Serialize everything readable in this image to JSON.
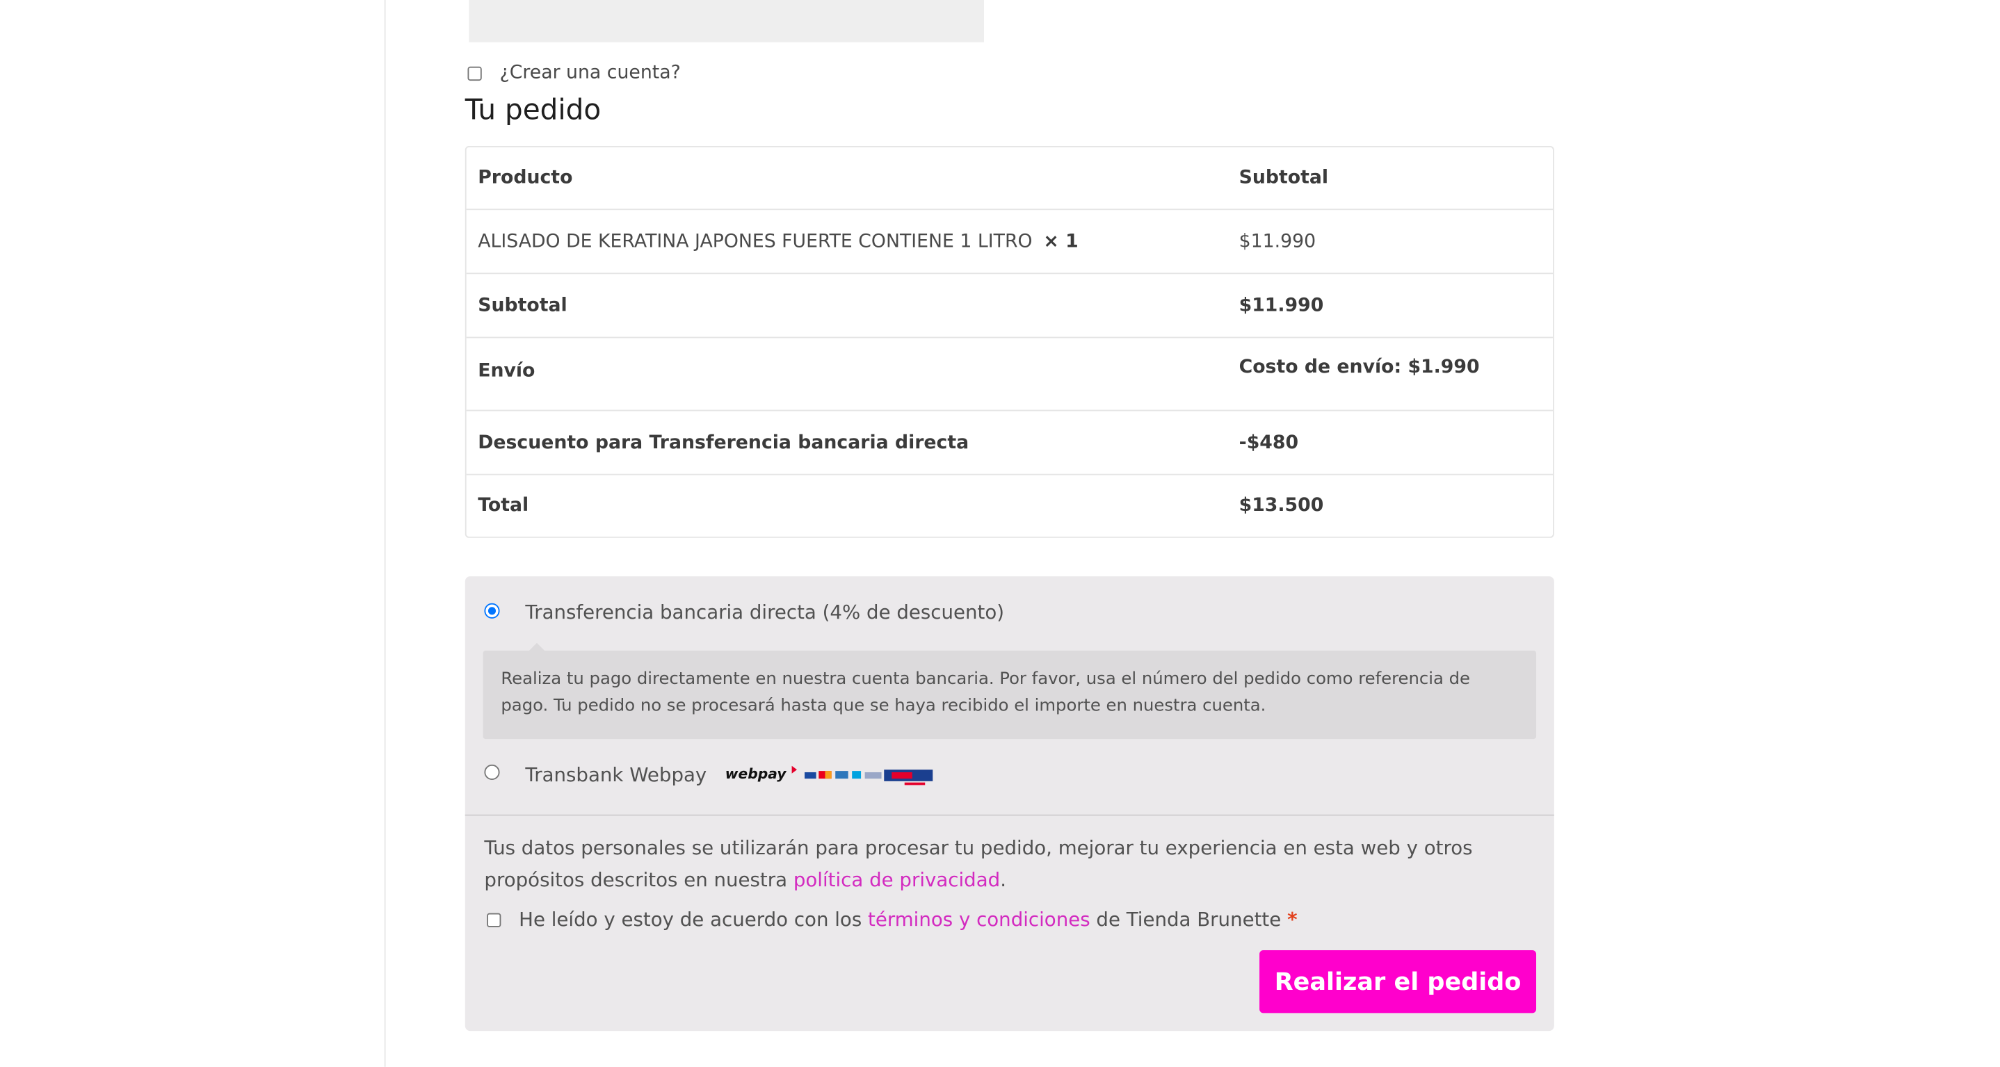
{
  "checkout": {
    "create_account_label": "¿Crear una cuenta?",
    "order_title": "Tu pedido"
  },
  "order": {
    "headers": {
      "product": "Producto",
      "subtotal": "Subtotal"
    },
    "item": {
      "name": "ALISADO DE KERATINA JAPONES FUERTE CONTIENE 1 LITRO",
      "qty": "× 1",
      "price": "$11.990"
    },
    "subtotal": {
      "label": "Subtotal",
      "value": "$11.990"
    },
    "shipping": {
      "label": "Envío",
      "value": "Costo de envío: $1.990"
    },
    "discount": {
      "label": "Descuento para Transferencia bancaria directa",
      "value": "-$480"
    },
    "total": {
      "label": "Total",
      "value": "$13.500"
    }
  },
  "payment": {
    "methods": [
      {
        "label": "Transferencia bancaria directa (4% de descuento)",
        "selected": true,
        "description": "Realiza tu pago directamente en nuestra cuenta bancaria. Por favor, usa el número del pedido como referencia de pago. Tu pedido no se procesará hasta que se haya recibido el importe en nuestra cuenta."
      },
      {
        "label": "Transbank Webpay",
        "selected": false,
        "logo_text": "webpay"
      }
    ],
    "privacy_text": "Tus datos personales se utilizarán para procesar tu pedido, mejorar tu experiencia en esta web y otros propósitos descritos en nuestra ",
    "privacy_link": "política de privacidad",
    "privacy_end": ".",
    "terms_prefix": "He leído y estoy de acuerdo con los ",
    "terms_link": "términos y condiciones",
    "terms_suffix": " de Tienda Brunette ",
    "terms_required": "*",
    "submit_label": "Realizar el pedido"
  },
  "colors": {
    "accent": "#ff00cc",
    "link": "#d32bc0",
    "radio": "#0075ff",
    "panel_bg": "#ebe9eb"
  }
}
